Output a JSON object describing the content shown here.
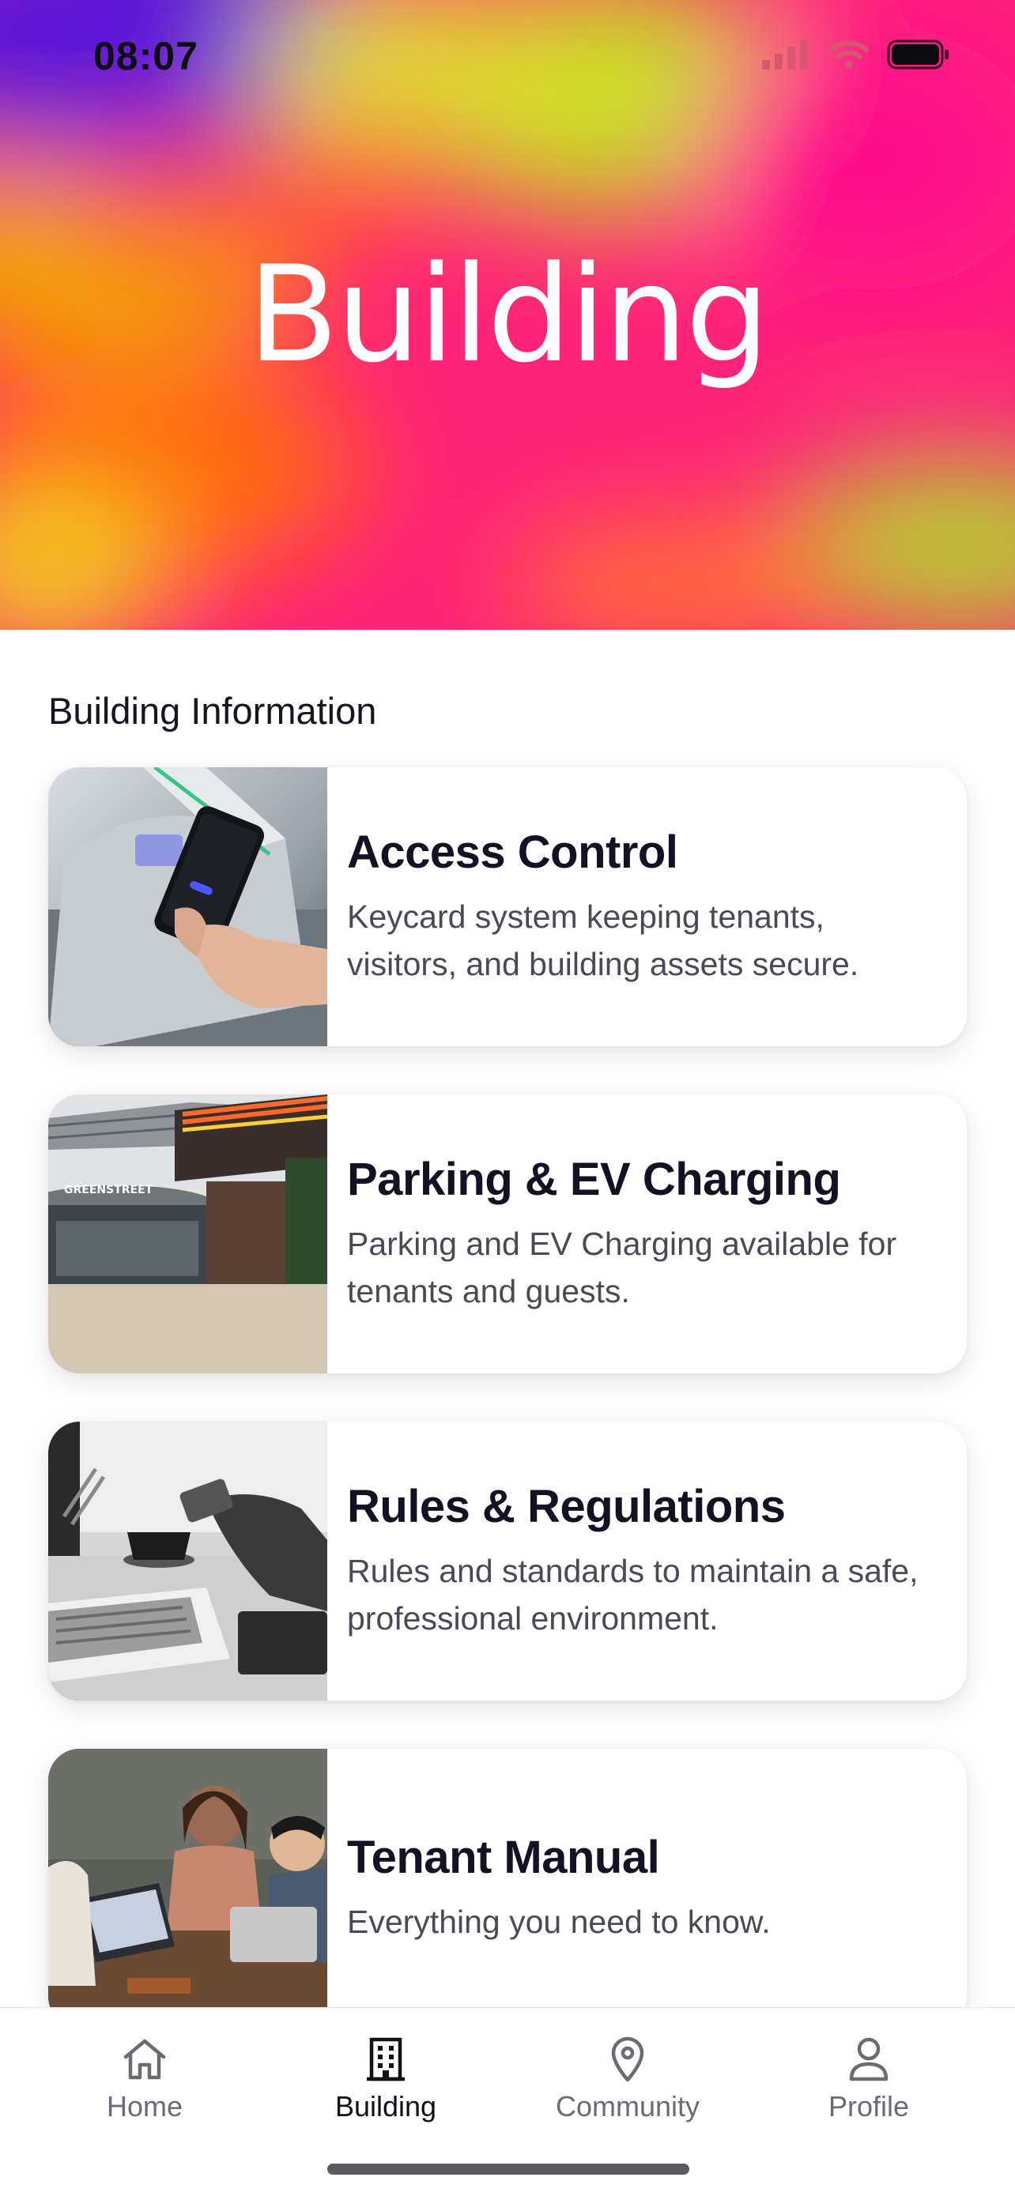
{
  "status_bar": {
    "time": "08:07"
  },
  "hero": {
    "title": "Building"
  },
  "section": {
    "title": "Building Information"
  },
  "cards": [
    {
      "title": "Access Control",
      "description": "Keycard system keeping tenants, visitors, and building assets secure."
    },
    {
      "title": "Parking & EV Charging",
      "description": "Parking and EV Charging available for tenants and guests."
    },
    {
      "title": "Rules & Regulations",
      "description": "Rules and standards to maintain a safe, professional environment."
    },
    {
      "title": "Tenant Manual",
      "description": "Everything you need to know."
    }
  ],
  "tabbar": {
    "items": [
      {
        "label": "Home",
        "icon": "home-icon",
        "active": false
      },
      {
        "label": "Building",
        "icon": "building-icon",
        "active": true
      },
      {
        "label": "Community",
        "icon": "map-pin-icon",
        "active": false
      },
      {
        "label": "Profile",
        "icon": "person-icon",
        "active": false
      }
    ]
  },
  "colors": {
    "accent_pink": "#ff1a7f",
    "text_dark": "#121224",
    "text_muted": "#4a4a56"
  }
}
